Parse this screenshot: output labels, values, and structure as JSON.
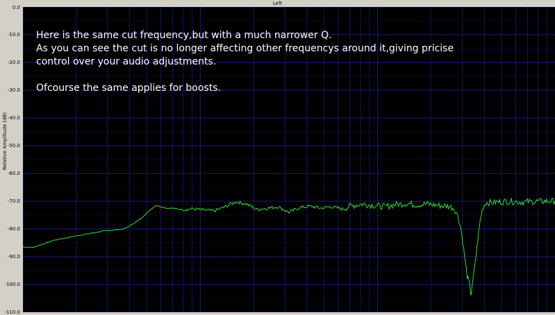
{
  "chart_data": {
    "type": "line",
    "title": "Left",
    "xlabel": "",
    "ylabel": "Relative Amplitude (dB)",
    "ylim": [
      -110,
      0
    ],
    "yticks": [
      "0.0",
      "-10.0",
      "-20.0",
      "-30.0",
      "-40.0",
      "-50.0",
      "-60.0",
      "-70.0",
      "-80.0",
      "-90.0",
      "-100.0",
      "-110.0"
    ],
    "xlim": [
      0,
      1
    ],
    "grid": true,
    "line_color": "#2fe02f",
    "grid_color": "#1a1a8c",
    "x": [
      0.0,
      0.02,
      0.06,
      0.1,
      0.15,
      0.19,
      0.2,
      0.22,
      0.24,
      0.25,
      0.27,
      0.28,
      0.3,
      0.32,
      0.34,
      0.36,
      0.38,
      0.4,
      0.42,
      0.44,
      0.46,
      0.48,
      0.5,
      0.52,
      0.54,
      0.56,
      0.58,
      0.6,
      0.62,
      0.64,
      0.66,
      0.68,
      0.7,
      0.72,
      0.74,
      0.76,
      0.78,
      0.8,
      0.81,
      0.815,
      0.82,
      0.825,
      0.83,
      0.835,
      0.84,
      0.842,
      0.845,
      0.85,
      0.855,
      0.86,
      0.865,
      0.87,
      0.88,
      0.9,
      0.92,
      0.94,
      0.96,
      0.98,
      1.0
    ],
    "y": [
      -86.5,
      -86.6,
      -84.0,
      -82.5,
      -80.8,
      -80.0,
      -79.0,
      -76.5,
      -73.0,
      -71.5,
      -72.5,
      -72.5,
      -73.0,
      -72.8,
      -73.2,
      -73.5,
      -72.0,
      -70.2,
      -71.0,
      -73.0,
      -72.5,
      -72.0,
      -74.0,
      -72.3,
      -71.8,
      -72.5,
      -72.0,
      -72.8,
      -71.5,
      -71.0,
      -71.5,
      -72.0,
      -71.2,
      -70.8,
      -71.3,
      -71.0,
      -71.5,
      -71.8,
      -72.5,
      -74.0,
      -77.0,
      -82.0,
      -90.0,
      -97.0,
      -100.5,
      -103.5,
      -100.0,
      -92.0,
      -84.0,
      -76.0,
      -72.0,
      -70.5,
      -70.5,
      -70.2,
      -70.0,
      -70.3,
      -70.1,
      -70.0,
      -70.0
    ]
  },
  "annotation": {
    "lines": [
      "Here is the same cut frequency,but with a much narrower Q.",
      "As you can see the cut is no longer affecting other frequencys around it,giving pricise",
      "control over your audio adjustments.",
      "",
      "Ofcourse the same applies for boosts."
    ],
    "color": "#ffffff"
  }
}
